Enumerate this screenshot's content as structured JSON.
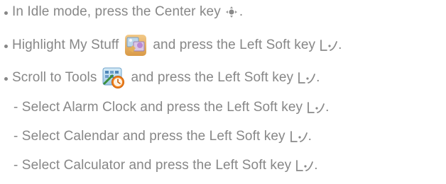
{
  "instructions": {
    "step1": {
      "text": "In Idle mode, press the Center key",
      "end": "."
    },
    "step2": {
      "text_before": "Highlight My Stuff",
      "text_after": "and press the Left Soft key",
      "end": "."
    },
    "step3": {
      "text_before": "Scroll to Tools",
      "text_after": "and press the Left Soft key",
      "end": "."
    },
    "sub1": {
      "text": "- Select Alarm Clock and press the Left Soft key",
      "end": "."
    },
    "sub2": {
      "text": "- Select Calendar and press the Left Soft key",
      "end": "."
    },
    "sub3": {
      "text": "- Select Calculator and press the Left Soft key",
      "end": "."
    }
  },
  "icons": {
    "center_key": "center-key-icon",
    "left_soft_key": "left-soft-key-icon",
    "my_stuff": "my-stuff-icon",
    "tools": "tools-icon"
  },
  "colors": {
    "text": "#878787"
  }
}
